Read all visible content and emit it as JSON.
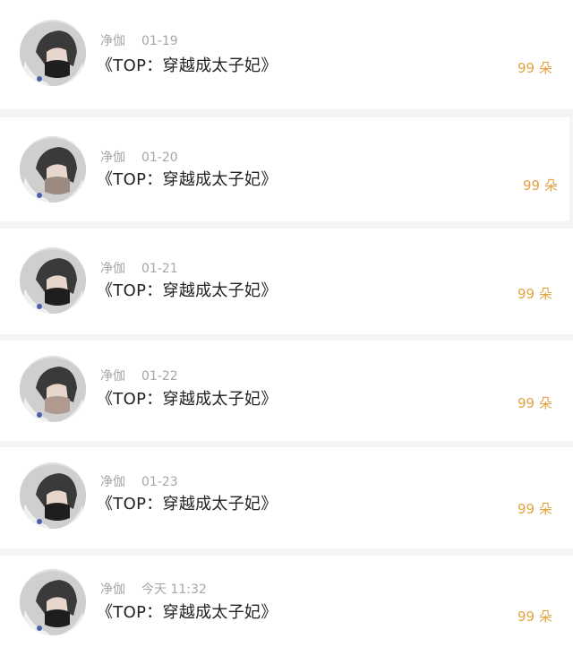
{
  "records": [
    {
      "sender": "净伽",
      "time": "01-19",
      "title": "《TOP：穿越成太子妃》",
      "amount": "99 朵"
    },
    {
      "sender": "净伽",
      "time": "01-20",
      "title": "《TOP：穿越成太子妃》",
      "amount": "99 朵"
    },
    {
      "sender": "净伽",
      "time": "01-21",
      "title": "《TOP：穿越成太子妃》",
      "amount": "99 朵"
    },
    {
      "sender": "净伽",
      "time": "01-22",
      "title": "《TOP：穿越成太子妃》",
      "amount": "99 朵"
    },
    {
      "sender": "净伽",
      "time": "01-23",
      "title": "《TOP：穿越成太子妃》",
      "amount": "99 朵"
    },
    {
      "sender": "净伽",
      "time": "今天 11:32",
      "title": "《TOP：穿越成太子妃》",
      "amount": "99 朵"
    }
  ],
  "colors": {
    "amount": "#e3a243",
    "meta": "#a6a6a6",
    "title": "#222222"
  },
  "icons": {
    "avatar": "hooded-masked-person-avatar"
  }
}
